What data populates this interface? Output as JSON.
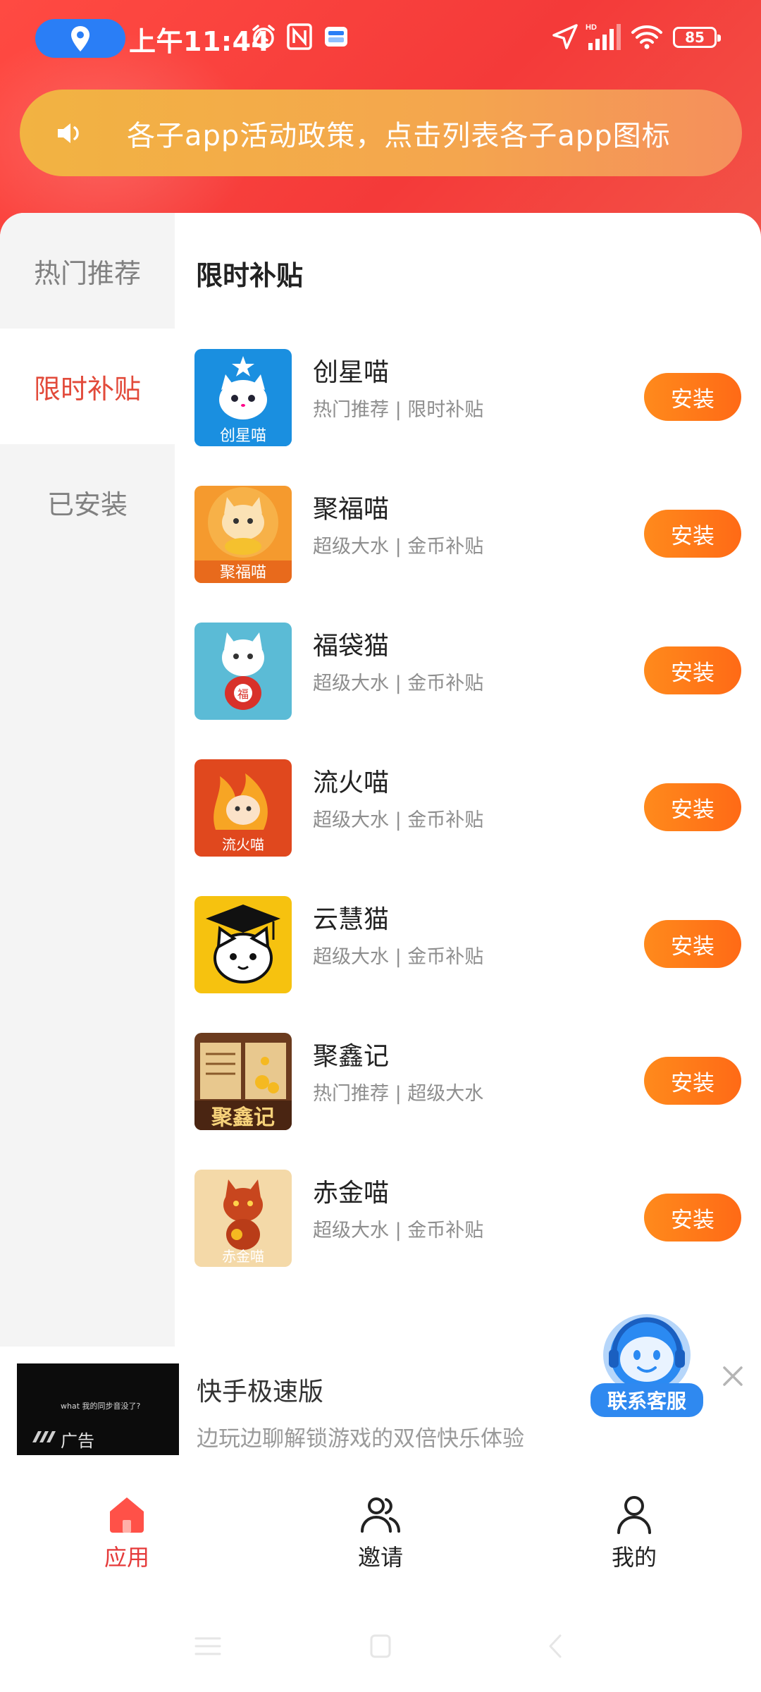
{
  "status_bar": {
    "time": "上午11:44",
    "battery": "85",
    "network_badge": "HD",
    "icons": [
      "location-pin-icon",
      "alarm-icon",
      "nfc-icon",
      "wallet-icon",
      "navigation-arrow-icon",
      "cell-signal-icon",
      "wifi-icon",
      "battery-icon"
    ]
  },
  "notice": {
    "icon": "speaker-icon",
    "text": "各子app活动政策，点击列表各子app图标"
  },
  "sidebar": {
    "items": [
      {
        "label": "热门推荐",
        "active": false
      },
      {
        "label": "限时补贴",
        "active": true
      },
      {
        "label": "已安装",
        "active": false
      }
    ]
  },
  "section": {
    "title": "限时补贴"
  },
  "apps": [
    {
      "name": "创星喵",
      "tags": "热门推荐 | 限时补贴",
      "button": "安装",
      "icon_label": "创星喵",
      "icon_bg": "#1a8fe0"
    },
    {
      "name": "聚福喵",
      "tags": "超级大水 | 金币补贴",
      "button": "安装",
      "icon_label": "聚福喵",
      "icon_bg": "#f59a2e"
    },
    {
      "name": "福袋猫",
      "tags": "超级大水 | 金币补贴",
      "button": "安装",
      "icon_label": "",
      "icon_bg": "#5bbbd6"
    },
    {
      "name": "流火喵",
      "tags": "超级大水 | 金币补贴",
      "button": "安装",
      "icon_label": "流火喵",
      "icon_bg": "#e0481e"
    },
    {
      "name": "云慧猫",
      "tags": "超级大水 | 金币补贴",
      "button": "安装",
      "icon_label": "",
      "icon_bg": "#f6c20f"
    },
    {
      "name": "聚鑫记",
      "tags": "热门推荐 | 超级大水",
      "button": "安装",
      "icon_label": "聚鑫记",
      "icon_bg": "#6b3b1e"
    },
    {
      "name": "赤金喵",
      "tags": "超级大水 | 金币补贴",
      "button": "安装",
      "icon_label": "赤金喵",
      "icon_bg": "#f4d9a8"
    }
  ],
  "ad": {
    "thumb_caption": "what 我的同步音没了?",
    "label": "广告",
    "title": "快手极速版",
    "description": "边玩边聊解锁游戏的双倍快乐体验"
  },
  "service": {
    "label": "联系客服",
    "icon": "robot-headset-icon"
  },
  "bottom_nav": {
    "items": [
      {
        "label": "应用",
        "icon": "home-icon",
        "active": true
      },
      {
        "label": "邀请",
        "icon": "users-icon",
        "active": false
      },
      {
        "label": "我的",
        "icon": "user-icon",
        "active": false
      }
    ]
  },
  "colors": {
    "header_red": "#f43a39",
    "notice_gradient_start": "#f2b342",
    "notice_gradient_end": "#f58f5c",
    "install_orange": "#ff7a18",
    "active_red": "#e24a3a",
    "service_blue": "#2f89f0"
  }
}
